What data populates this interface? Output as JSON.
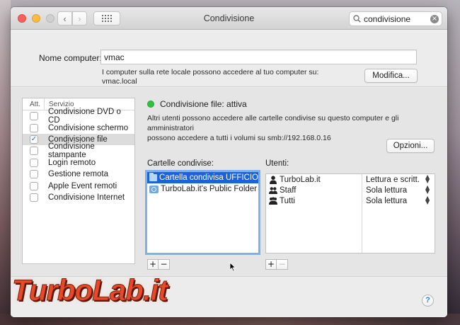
{
  "window": {
    "title": "Condivisione",
    "search": {
      "value": "condivisione"
    }
  },
  "computer": {
    "label": "Nome computer:",
    "value": "vmac",
    "info_line1": "I computer sulla rete locale possono accedere al tuo computer su:",
    "info_line2": "vmac.local",
    "edit_button": "Modifica..."
  },
  "services": {
    "col_att": "Att.",
    "col_service": "Servizio",
    "items": [
      {
        "label": "Condivisione DVD o CD",
        "checked": false
      },
      {
        "label": "Condivisione schermo",
        "checked": false
      },
      {
        "label": "Condivisione file",
        "checked": true,
        "selected": true
      },
      {
        "label": "Condivisione stampante",
        "checked": false
      },
      {
        "label": "Login remoto",
        "checked": false
      },
      {
        "label": "Gestione remota",
        "checked": false
      },
      {
        "label": "Apple Event remoti",
        "checked": false
      },
      {
        "label": "Condivisione Internet",
        "checked": false
      }
    ]
  },
  "file_sharing": {
    "status_color": "#2fc33c",
    "status": "Condivisione file: attiva",
    "desc_line1": "Altri utenti possono accedere alle cartelle condivise su questo computer e gli amministratori",
    "desc_line2": "possono accedere a tutti i volumi su smb://192.168.0.16",
    "options_button": "Opzioni..."
  },
  "shared_folders": {
    "label": "Cartelle condivise:",
    "items": [
      {
        "label": "Cartella condivisa UFFICIO",
        "selected": true,
        "icon": "folder-icon"
      },
      {
        "label": "TurboLab.it's Public Folder",
        "selected": false,
        "icon": "public-folder-icon"
      }
    ],
    "add": "+",
    "remove": "−"
  },
  "users": {
    "label": "Utenti:",
    "items": [
      {
        "name": "TurboLab.it",
        "permission": "Lettura e scritt.",
        "icon": "user-icon"
      },
      {
        "name": "Staff",
        "permission": "Sola lettura",
        "icon": "group-icon"
      },
      {
        "name": "Tutti",
        "permission": "Sola lettura",
        "icon": "everyone-icon"
      }
    ],
    "add": "+",
    "remove": "−"
  },
  "help": "?",
  "watermark": "TurboLab.it"
}
